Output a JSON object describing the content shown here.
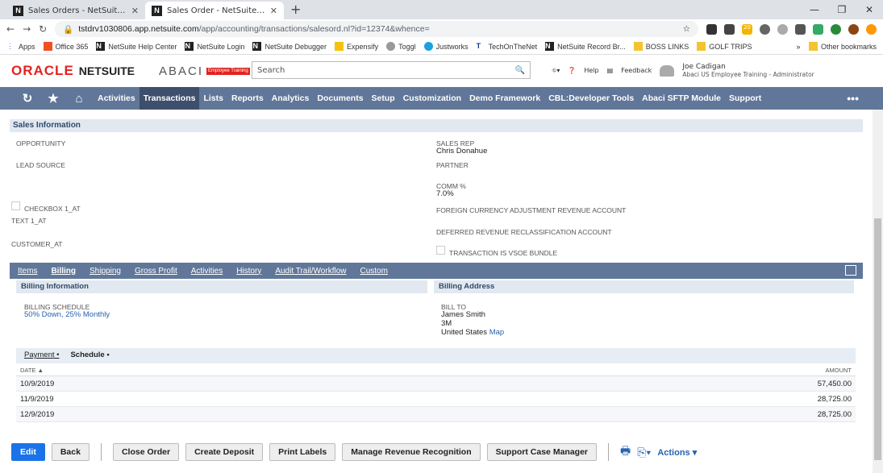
{
  "browser": {
    "tabs": [
      {
        "label": "Sales Orders - NetSuite (Abaci US",
        "active": false
      },
      {
        "label": "Sales Order - NetSuite (Abaci US",
        "active": true
      }
    ],
    "url_host": "tstdrv1030806.app.netsuite.com",
    "url_path": "/app/accounting/transactions/salesord.nl?id=12374&whence=",
    "bookmarks": [
      "Apps",
      "Office 365",
      "NetSuite Help Center",
      "NetSuite Login",
      "NetSuite Debugger",
      "Expensify",
      "Toggl",
      "Justworks",
      "TechOnTheNet",
      "NetSuite Record Br...",
      "BOSS LINKS",
      "GOLF TRIPS"
    ],
    "other_bookmarks": "Other bookmarks",
    "ext_badge": "20"
  },
  "header": {
    "oracle": "ORACLE",
    "netsuite": "NETSUITE",
    "abaci": "ABACI",
    "abaci_tag": "Employee Training",
    "search_placeholder": "Search",
    "help": "Help",
    "feedback": "Feedback",
    "user_name": "Joe Cadigan",
    "user_role": "Abaci US Employee Training - Administrator"
  },
  "nav": {
    "items": [
      "Activities",
      "Transactions",
      "Lists",
      "Reports",
      "Analytics",
      "Documents",
      "Setup",
      "Customization",
      "Demo Framework",
      "CBL:Developer Tools",
      "Abaci SFTP Module",
      "Support"
    ],
    "active": "Transactions",
    "more": "•••"
  },
  "sales_info": {
    "title": "Sales Information",
    "opportunity": "OPPORTUNITY",
    "lead_source": "LEAD SOURCE",
    "checkbox_label": "CHECKBOX 1_AT",
    "text1": "TEXT 1_AT",
    "customer_at": "CUSTOMER_AT",
    "sales_rep_label": "SALES REP",
    "sales_rep": "Chris Donahue",
    "partner": "PARTNER",
    "comm_label": "COMM %",
    "comm": "7.0%",
    "fx_account": "FOREIGN CURRENCY ADJUSTMENT REVENUE ACCOUNT",
    "deferred": "DEFERRED REVENUE RECLASSIFICATION ACCOUNT",
    "vsoe": "TRANSACTION IS VSOE BUNDLE"
  },
  "subtabs": [
    "Items",
    "Billing",
    "Shipping",
    "Gross Profit",
    "Activities",
    "History",
    "Audit Trail/Workflow",
    "Custom"
  ],
  "billing": {
    "info_title": "Billing Information",
    "address_title": "Billing Address",
    "schedule_label": "BILLING SCHEDULE",
    "schedule": "50% Down, 25% Monthly",
    "bill_to_label": "BILL TO",
    "bill_to_name": "James Smith",
    "bill_to_company": "3M",
    "bill_to_country": "United States",
    "map": "Map"
  },
  "payment_tabs": [
    {
      "label": "Payment •",
      "active": false
    },
    {
      "label": "Schedule •",
      "active": true
    }
  ],
  "schedule_table": {
    "col_date": "DATE ▲",
    "col_amount": "AMOUNT",
    "rows": [
      {
        "date": "10/9/2019",
        "amount": "57,450.00"
      },
      {
        "date": "11/9/2019",
        "amount": "28,725.00"
      },
      {
        "date": "12/9/2019",
        "amount": "28,725.00"
      }
    ]
  },
  "actions": {
    "edit": "Edit",
    "back": "Back",
    "close_order": "Close Order",
    "create_deposit": "Create Deposit",
    "print_labels": "Print Labels",
    "manage_rev": "Manage Revenue Recognition",
    "support_case": "Support Case Manager",
    "actions": "Actions ▾"
  }
}
